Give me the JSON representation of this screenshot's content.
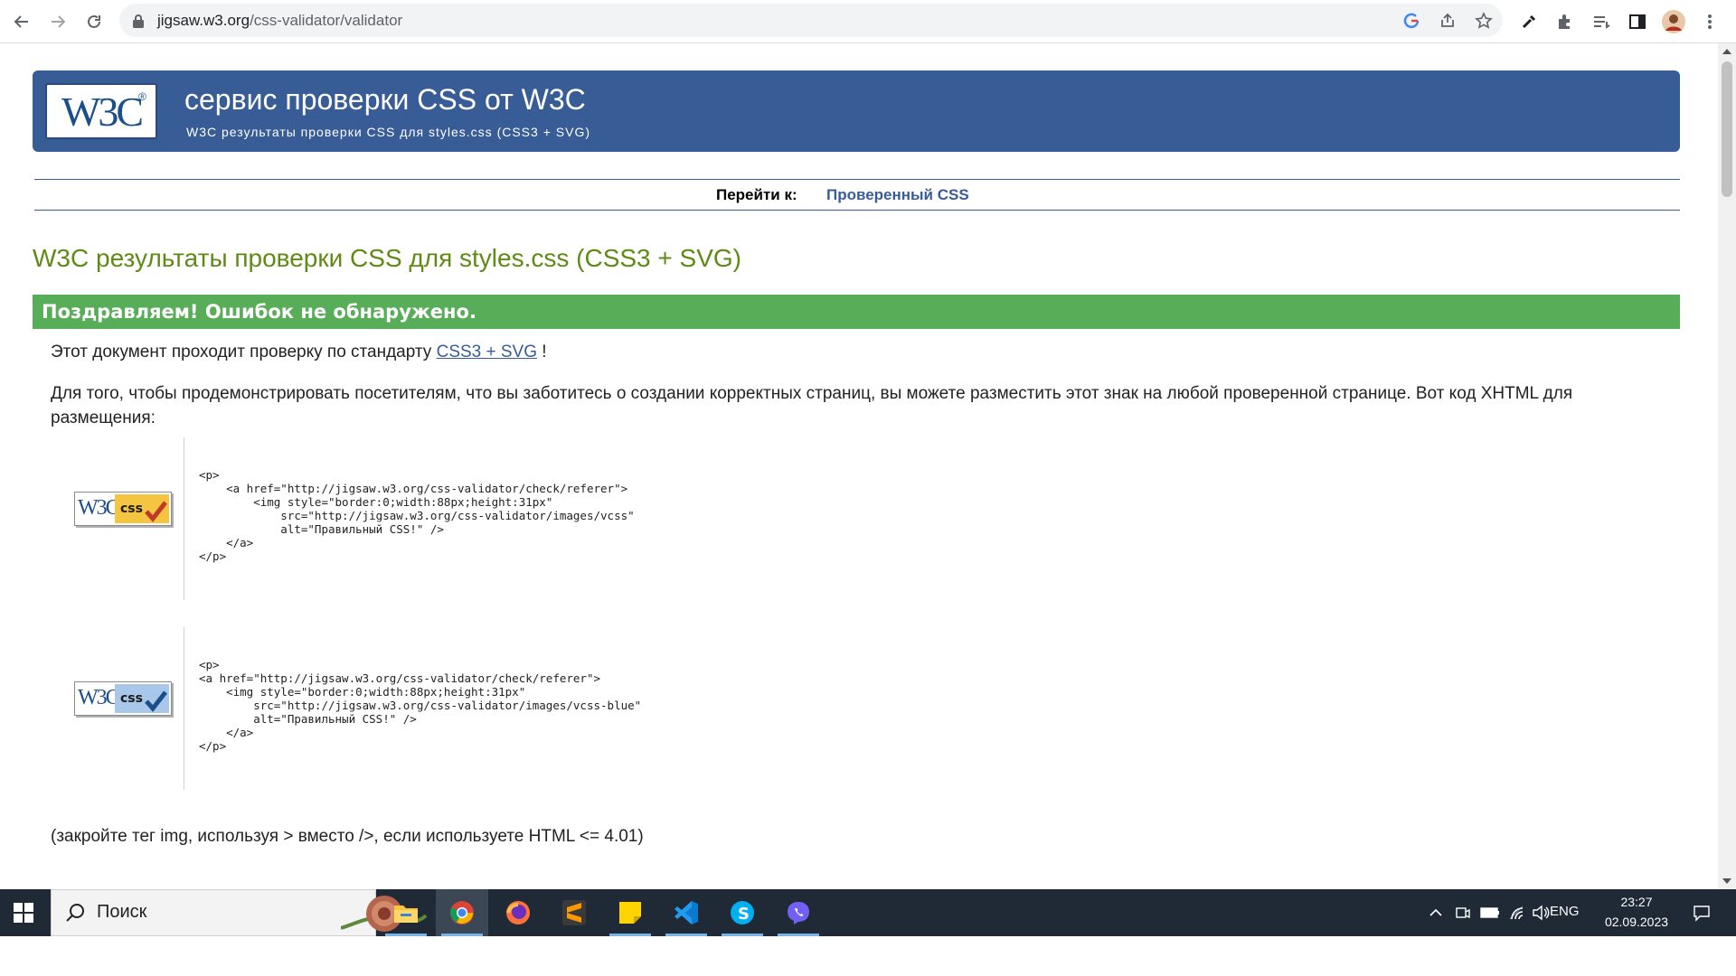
{
  "browser": {
    "url_host": "jigsaw.w3.org",
    "url_path": "/css-validator/validator"
  },
  "banner": {
    "logo_text": "W3C",
    "logo_mark": "®",
    "title": "сервис проверки CSS от W3C",
    "subtitle": "W3C результаты проверки CSS для styles.css (CSS3 + SVG)"
  },
  "jump": {
    "label": "Перейти к:",
    "link": "Проверенный CSS"
  },
  "results": {
    "heading": "W3C результаты проверки CSS для styles.css (CSS3 + SVG)",
    "success": "Поздравляем! Ошибок не обнаружено.",
    "pass_prefix": "Этот документ проходит проверку по стандарту ",
    "pass_link": "CSS3 + SVG",
    "pass_suffix": " !",
    "display_text": "Для того, чтобы продемонстрировать посетителям, что вы заботитесь о создании корректных страниц, вы можете разместить этот знак на любой проверенной странице. Вот код XHTML для размещения:",
    "footer_note": "(закройте тег img, используя > вместо />, если используете HTML <= 4.01)"
  },
  "badges": [
    {
      "w3c": "W3C",
      "css": "css",
      "color": "#f5c542",
      "check_color": "#c0392b",
      "code": "<p>\n    <a href=\"http://jigsaw.w3.org/css-validator/check/referer\">\n        <img style=\"border:0;width:88px;height:31px\"\n            src=\"http://jigsaw.w3.org/css-validator/images/vcss\"\n            alt=\"Правильный CSS!\" />\n    </a>\n</p>"
    },
    {
      "w3c": "W3C",
      "css": "css",
      "color": "#a9c7e8",
      "check_color": "#1a4f8b",
      "code": "<p>\n<a href=\"http://jigsaw.w3.org/css-validator/check/referer\">\n    <img style=\"border:0;width:88px;height:31px\"\n        src=\"http://jigsaw.w3.org/css-validator/images/vcss-blue\"\n        alt=\"Правильный CSS!\" />\n    </a>\n</p>"
    }
  ],
  "taskbar": {
    "search_placeholder": "Поиск",
    "lang": "ENG",
    "time": "23:27",
    "date": "02.09.2023",
    "apps": [
      "file-explorer",
      "chrome",
      "firefox",
      "sublime-text",
      "sticky-notes",
      "vscode",
      "skype",
      "viber"
    ]
  },
  "colors": {
    "banner": "#385c95",
    "heading": "#5f8a16",
    "success": "#58ad58",
    "taskbar": "#1f2a36"
  }
}
